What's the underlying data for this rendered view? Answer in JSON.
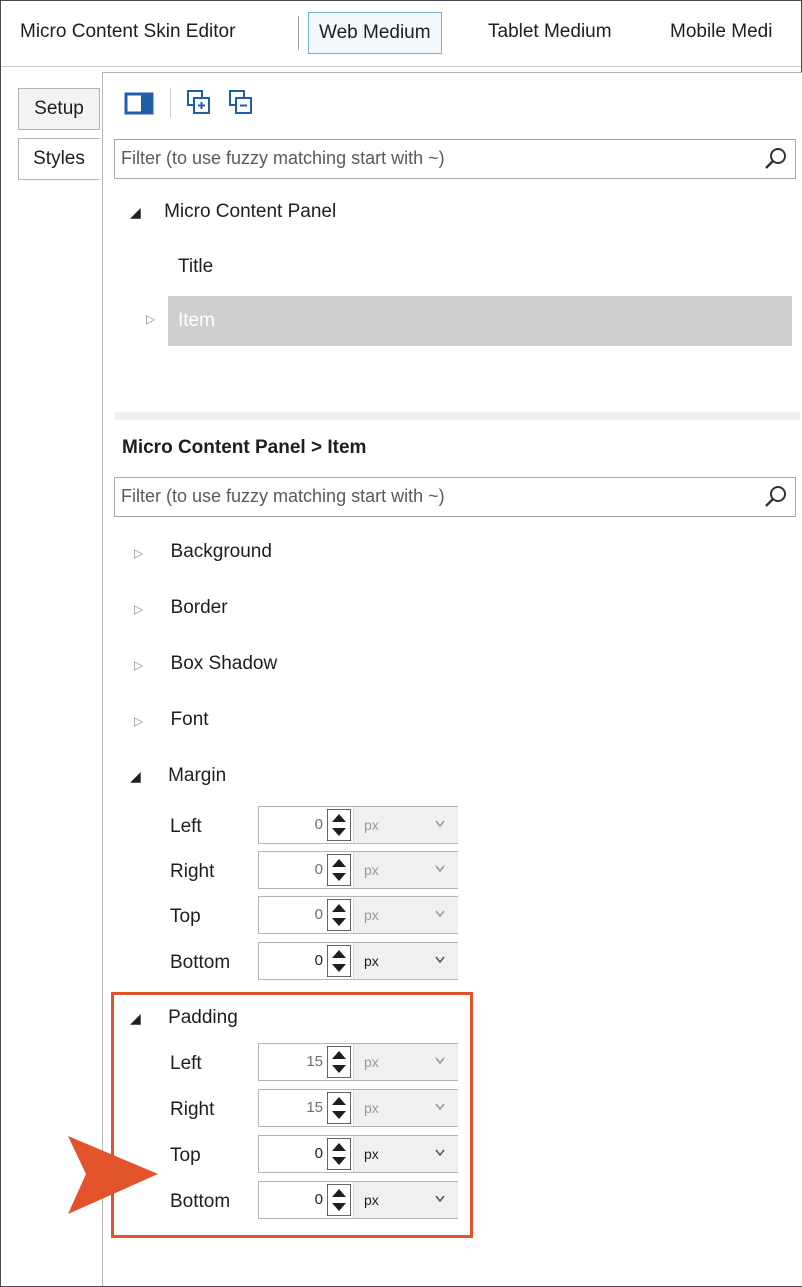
{
  "tabs": [
    "Micro Content Skin Editor",
    "Web Medium",
    "Tablet Medium",
    "Mobile Medi"
  ],
  "active_tab": "Web Medium",
  "left_tabs": {
    "setup": "Setup",
    "styles": "Styles"
  },
  "filter_placeholder": "Filter (to use fuzzy matching start with ~)",
  "tree": {
    "root": "Micro Content Panel",
    "title": "Title",
    "item": "Item"
  },
  "breadcrumb": "Micro Content Panel > Item",
  "properties": {
    "background": "Background",
    "border": "Border",
    "box_shadow": "Box Shadow",
    "font": "Font",
    "margin": {
      "label": "Margin",
      "left": {
        "label": "Left",
        "value": "0",
        "unit": "px"
      },
      "right": {
        "label": "Right",
        "value": "0",
        "unit": "px"
      },
      "top": {
        "label": "Top",
        "value": "0",
        "unit": "px"
      },
      "bottom": {
        "label": "Bottom",
        "value": "0",
        "unit": "px"
      }
    },
    "padding": {
      "label": "Padding",
      "left": {
        "label": "Left",
        "value": "15",
        "unit": "px"
      },
      "right": {
        "label": "Right",
        "value": "15",
        "unit": "px"
      },
      "top": {
        "label": "Top",
        "value": "0",
        "unit": "px"
      },
      "bottom": {
        "label": "Bottom",
        "value": "0",
        "unit": "px"
      }
    }
  },
  "colors": {
    "highlight": "#e2522b",
    "active_tab_border": "#7aaee0",
    "selection": "#cfcfcf"
  }
}
